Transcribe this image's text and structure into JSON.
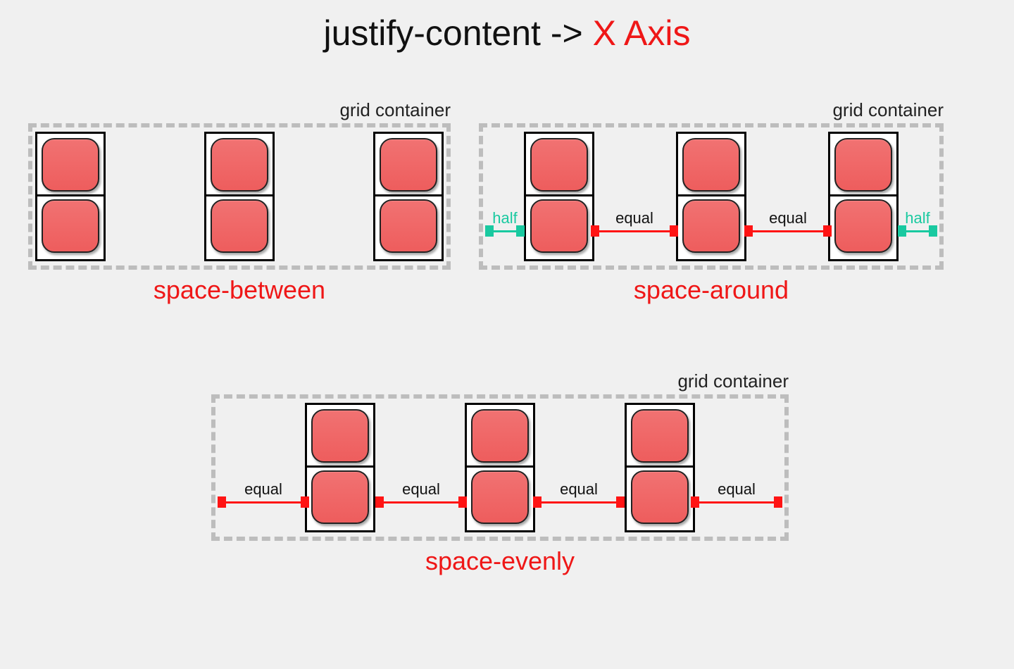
{
  "title": {
    "prefix": "justify-content -> ",
    "accent": "X Axis"
  },
  "containerLabel": "grid container",
  "panels": {
    "between": {
      "caption": "space-between"
    },
    "around": {
      "caption": "space-around",
      "arrows": {
        "outerLabel": "half",
        "innerLabel": "equal"
      }
    },
    "evenly": {
      "caption": "space-evenly",
      "arrows": {
        "label": "equal"
      }
    }
  },
  "colors": {
    "accent": "#ef1717",
    "arrowRed": "#ff1414",
    "arrowTeal": "#19c9a0"
  }
}
